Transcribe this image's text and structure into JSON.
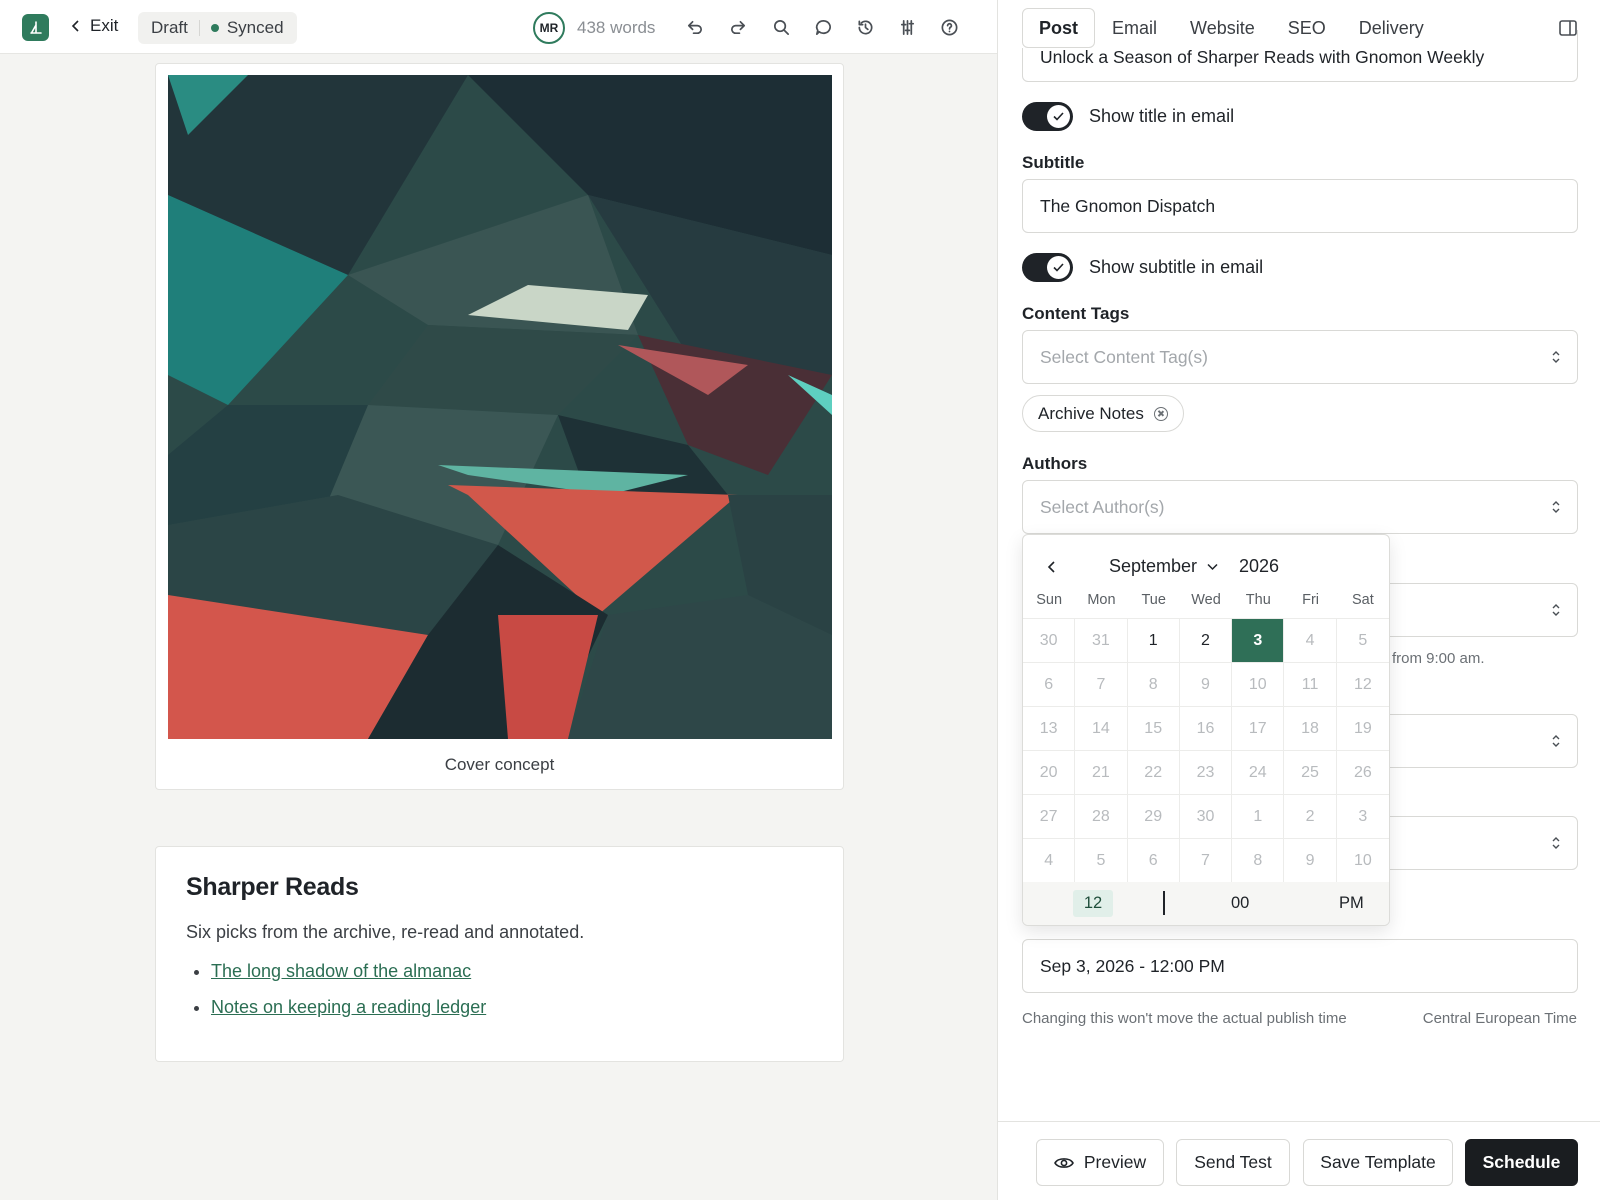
{
  "topbar": {
    "exit_label": "Exit",
    "status": "Draft",
    "sync_status": "Synced",
    "avatar_initials": "MR",
    "word_count": "438 words"
  },
  "editor": {
    "cover_caption": "Cover concept",
    "heading": "Sharper Reads",
    "intro": "Six picks from the archive, re-read and annotated.",
    "links": [
      "The long shadow of the almanac",
      "Notes on keeping a reading ledger"
    ]
  },
  "panel": {
    "tabs": [
      "Post",
      "Email",
      "Website",
      "SEO",
      "Delivery"
    ],
    "active_tab": "Post",
    "title_value": "Unlock a Season of Sharper Reads with Gnomon Weekly",
    "show_title_label": "Show title in email",
    "show_title_on": true,
    "subtitle_label": "Subtitle",
    "subtitle_value": "The Gnomon Dispatch",
    "show_subtitle_label": "Show subtitle in email",
    "show_subtitle_on": true,
    "content_tags_label": "Content Tags",
    "content_tags_placeholder": "Select Content Tag(s)",
    "tag_chip": "Archive Notes",
    "authors_label": "Authors",
    "authors_placeholder": "Select Author(s)",
    "partial_hint": "from 9:00 am.",
    "schedule_value": "Sep 3, 2026 - 12:00 PM",
    "schedule_hint": "Changing this won't move the actual publish time",
    "timezone": "Central European Time"
  },
  "actions": {
    "preview": "Preview",
    "send_test": "Send Test",
    "save_template": "Save Template",
    "schedule": "Schedule"
  },
  "datepicker": {
    "month": "September",
    "year": "2026",
    "weekdays": [
      "Sun",
      "Mon",
      "Tue",
      "Wed",
      "Thu",
      "Fri",
      "Sat"
    ],
    "days": [
      [
        "30",
        false
      ],
      [
        "31",
        false
      ],
      [
        "1",
        true
      ],
      [
        "2",
        true
      ],
      [
        "3",
        true
      ],
      [
        "4",
        false
      ],
      [
        "5",
        false
      ],
      [
        "6",
        false
      ],
      [
        "7",
        false
      ],
      [
        "8",
        false
      ],
      [
        "9",
        false
      ],
      [
        "10",
        false
      ],
      [
        "11",
        false
      ],
      [
        "12",
        false
      ],
      [
        "13",
        false
      ],
      [
        "14",
        false
      ],
      [
        "15",
        false
      ],
      [
        "16",
        false
      ],
      [
        "17",
        false
      ],
      [
        "18",
        false
      ],
      [
        "19",
        false
      ],
      [
        "20",
        false
      ],
      [
        "21",
        false
      ],
      [
        "22",
        false
      ],
      [
        "23",
        false
      ],
      [
        "24",
        false
      ],
      [
        "25",
        false
      ],
      [
        "26",
        false
      ],
      [
        "27",
        false
      ],
      [
        "28",
        false
      ],
      [
        "29",
        false
      ],
      [
        "30",
        false
      ],
      [
        "1",
        false
      ],
      [
        "2",
        false
      ],
      [
        "3",
        false
      ],
      [
        "4",
        false
      ],
      [
        "5",
        false
      ],
      [
        "6",
        false
      ],
      [
        "7",
        false
      ],
      [
        "8",
        false
      ],
      [
        "9",
        false
      ],
      [
        "10",
        false
      ]
    ],
    "selected_index": 4,
    "hour": "12",
    "minute": "00",
    "ampm": "PM"
  },
  "colors": {
    "accent": "#2f7b5d",
    "selected_day": "#2f6f57",
    "primary_button": "#1a1d20",
    "link": "#2b6e53"
  },
  "icons": [
    "logo-icon",
    "chevron-left-icon",
    "undo-icon",
    "redo-icon",
    "search-icon",
    "comment-icon",
    "history-icon",
    "settings-sliders-icon",
    "help-icon",
    "sidebar-toggle-icon",
    "check-icon",
    "chevron-updown-icon",
    "close-circle-icon",
    "eye-icon"
  ]
}
